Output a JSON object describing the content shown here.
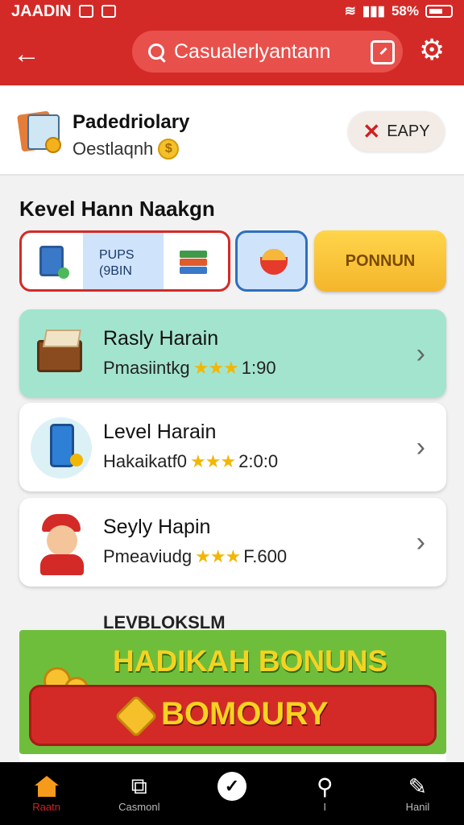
{
  "status_bar": {
    "app_name": "JAADIN",
    "battery": "58%"
  },
  "header": {
    "back_icon": "arrow-left-icon",
    "search_text": "Casualerlyantann"
  },
  "profile": {
    "title": "Padedriolary",
    "subtitle": "Oestlaqnh",
    "coin_symbol": "$",
    "easy_label": "EAPY"
  },
  "section_title": "Kevel Hann Naakgn",
  "chips": {
    "chip1_label": "PUPS\n(9BIN",
    "chip3_label": "PONNUN"
  },
  "cards": [
    {
      "title": "Rasly Harain",
      "sub": "Pmasiintkg",
      "stars": "★★★",
      "value": "1:90"
    },
    {
      "title": "Level Harain",
      "sub": "Hakaikatf0",
      "stars": "★★★",
      "value": "2:0:0"
    },
    {
      "title": "Seyly Hapin",
      "sub": "Pmeaviudg",
      "stars": "★★★",
      "value": "F.600"
    }
  ],
  "promo": {
    "label": "LEVBLOKSLM",
    "headline": "HADIKAH BONUNS",
    "button": "BOMOURY"
  },
  "bottom_nav": [
    {
      "label": "Raatn",
      "icon": "home-icon"
    },
    {
      "label": "Casmonl",
      "icon": "grid-icon"
    },
    {
      "label": "",
      "icon": "check-icon"
    },
    {
      "label": "I",
      "icon": "location-icon"
    },
    {
      "label": "Hanil",
      "icon": "tag-icon"
    }
  ]
}
